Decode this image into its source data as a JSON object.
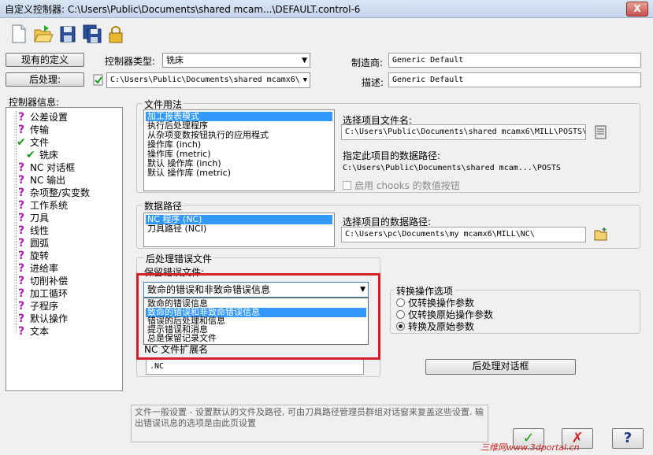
{
  "window": {
    "title": "自定义控制器: C:\\Users\\Public\\Documents\\shared mcam...\\DEFAULT.control-6",
    "close_label": "X"
  },
  "toolbar": {
    "icons": [
      "new-file-icon",
      "open-folder-icon",
      "save-icon",
      "save-all-icon",
      "lock-icon"
    ]
  },
  "top": {
    "existing_definition_label": "现有的定义",
    "controller_type_label": "控制器类型:",
    "controller_type_value": "铣床",
    "manufacturer_label": "制造商:",
    "manufacturer_value": "Generic Default",
    "post_label": "后处理:",
    "post_value": "C:\\Users\\Public\\Documents\\shared mcamx6\\",
    "description_label": "描述:",
    "description_value": "Generic Default"
  },
  "tree": {
    "header": "控制器信息:",
    "items": [
      {
        "label": "公差设置",
        "icon": "question-icon"
      },
      {
        "label": "传输",
        "icon": "question-icon"
      },
      {
        "label": "文件",
        "icon": "check-icon"
      },
      {
        "label": "铣床",
        "icon": "check-icon"
      },
      {
        "label": "NC 对话框",
        "icon": "question-icon"
      },
      {
        "label": "NC 输出",
        "icon": "question-icon"
      },
      {
        "label": "杂项整/实变数",
        "icon": "question-icon"
      },
      {
        "label": "工作系统",
        "icon": "question-icon"
      },
      {
        "label": "刀具",
        "icon": "question-icon"
      },
      {
        "label": "线性",
        "icon": "question-icon"
      },
      {
        "label": "圆弧",
        "icon": "question-icon"
      },
      {
        "label": "旋转",
        "icon": "question-icon"
      },
      {
        "label": "进给率",
        "icon": "question-icon"
      },
      {
        "label": "切削补偿",
        "icon": "question-icon"
      },
      {
        "label": "加工循环",
        "icon": "question-icon"
      },
      {
        "label": "子程序",
        "icon": "question-icon"
      },
      {
        "label": "默认操作",
        "icon": "question-icon"
      },
      {
        "label": "文本",
        "icon": "question-icon"
      }
    ]
  },
  "file_usage": {
    "group_label": "文件用法",
    "items": [
      "加工报表模式",
      "执行后处理程序",
      "从杂项变数按钮执行的应用程式",
      "操作库 (inch)",
      "操作库 (metric)",
      "默认 操作库 (inch)",
      "默认 操作库 (metric)"
    ],
    "selected_index": 0,
    "select_file_label": "选择项目文件名:",
    "select_file_value": "C:\\Users\\Public\\Documents\\shared mcamx6\\MILL\\POSTS\\",
    "data_path_label": "指定此项目的数据路径:",
    "data_path_value": "C:\\Users\\Public\\Documents\\shared mcam...\\POSTS",
    "chooks_label": "启用 chooks 的数值按钮"
  },
  "data_path": {
    "group_label": "数据路径",
    "items": [
      "NC 程序 (NC)",
      "刀具路径 (NCI)"
    ],
    "selected_index": 0,
    "select_path_label": "选择项目的数据路径:",
    "select_path_value": "C:\\Users\\pc\\Documents\\my mcamx6\\MILL\\NC\\"
  },
  "post_error": {
    "group_label": "后处理错误文件",
    "keep_label": "保留错误文件:",
    "selected_value": "致命的错误和非致命错误信息",
    "options": [
      "致命的错误信息",
      "致命的错误和非致命错误信息",
      "错误的后处理和信息",
      "提示错误和消息",
      "总是保留记录文件"
    ],
    "highlighted_index": 1,
    "ext_label": "NC 文件扩展名",
    "ext_value": ".NC"
  },
  "convert_options": {
    "group_label": "转换操作选项",
    "options": [
      "仅转换操作参数",
      "仅转换原始操作参数",
      "转换及原始参数"
    ],
    "selected_index": 2
  },
  "post_dialog_button": "后处理对话框",
  "description_text": "文件一般设置 - 设置默认的文件及路径, 可由刀具路径管理员群组对话窗来复盖这些设置. 输出错误讯息的选项是由此页设置",
  "bottom_buttons": {
    "ok": "✓",
    "cancel": "✗",
    "help": "?"
  },
  "watermark": "三维网www.3dportal.cn",
  "colors": {
    "accent_red": "#d4202a",
    "question": "#b01ab0",
    "check": "#1a9a1a",
    "selection": "#3399ff"
  }
}
